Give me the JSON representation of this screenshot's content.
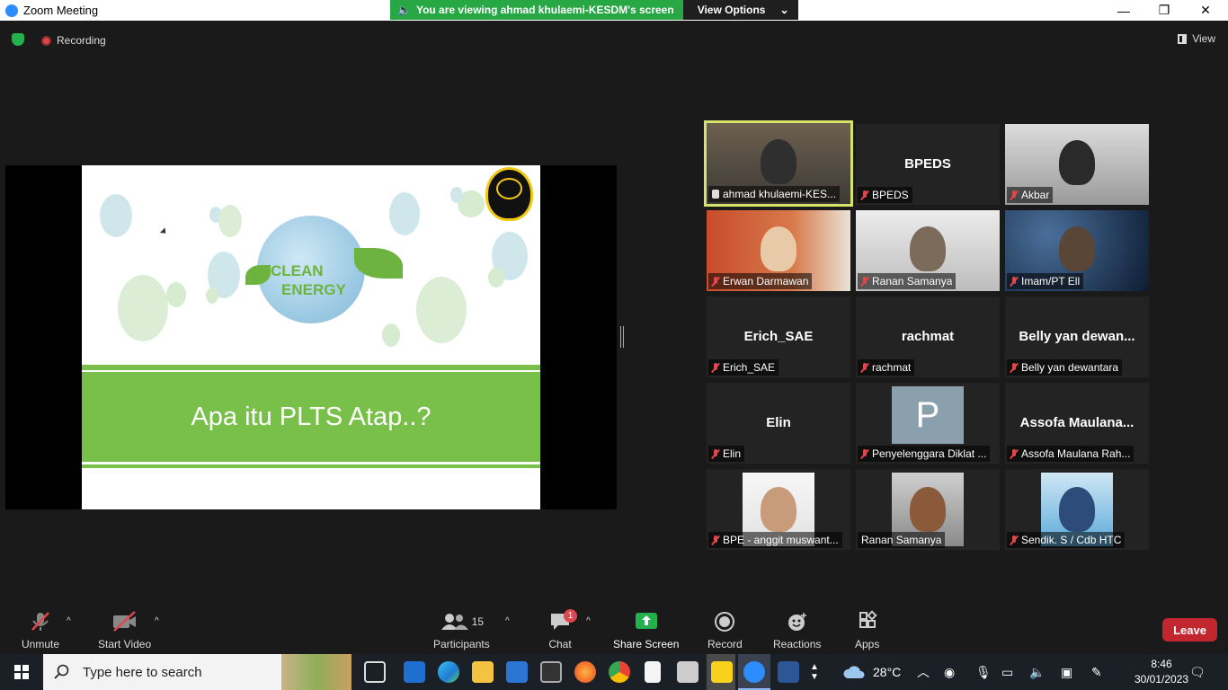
{
  "window": {
    "title": "Zoom Meeting",
    "minimize": "—",
    "restore": "❐",
    "close": "✕"
  },
  "share_banner": {
    "text": "You are viewing ahmad khulaemi-KESDM's screen",
    "options_label": "View Options",
    "chevron": "⌄"
  },
  "topbar": {
    "recording_label": "Recording",
    "view_label": "View"
  },
  "slide": {
    "logo_text": "CLEAN",
    "logo_text2": "ENERGY",
    "title": "Apa itu PLTS Atap..?"
  },
  "participants": [
    {
      "big": "",
      "caption": "ahmad khulaemi-KES...",
      "muted": false,
      "pinned": true,
      "active": true
    },
    {
      "big": "BPEDS",
      "caption": "BPEDS",
      "muted": true
    },
    {
      "big": "",
      "caption": "Akbar",
      "muted": true
    },
    {
      "big": "",
      "caption": "Erwan Darmawan",
      "muted": true
    },
    {
      "big": "",
      "caption": "Ranan Samanya",
      "muted": true
    },
    {
      "big": "",
      "caption": "Imam/PT Ell",
      "muted": true
    },
    {
      "big": "Erich_SAE",
      "caption": "Erich_SAE",
      "muted": true
    },
    {
      "big": "rachmat",
      "caption": "rachmat",
      "muted": true
    },
    {
      "big": "Belly yan dewan...",
      "caption": "Belly yan dewantara",
      "muted": true
    },
    {
      "big": "Elin",
      "caption": "Elin",
      "muted": true
    },
    {
      "big": "",
      "avatar_letter": "P",
      "caption": "Penyelenggara Diklat ...",
      "muted": true
    },
    {
      "big": "Assofa Maulana...",
      "caption": "Assofa Maulana Rah...",
      "muted": true
    },
    {
      "big": "",
      "caption": "BPE - anggit muswant...",
      "muted": true
    },
    {
      "big": "",
      "caption": "Ranan Samanya",
      "muted": false
    },
    {
      "big": "",
      "caption": "Sendik. S / Cdb HTC",
      "muted": true
    }
  ],
  "toolbar": {
    "unmute": "Unmute",
    "start_video": "Start Video",
    "participants": "Participants",
    "participants_count": "15",
    "chat": "Chat",
    "chat_badge": "1",
    "share_screen": "Share Screen",
    "record": "Record",
    "reactions": "Reactions",
    "apps": "Apps",
    "leave": "Leave",
    "caret": "^"
  },
  "taskbar": {
    "search_placeholder": "Type here to search",
    "weather": "28°C",
    "time": "8:46",
    "date": "30/01/2023"
  },
  "colors": {
    "share_green": "#28a745",
    "leave_red": "#c2262f",
    "slide_green": "#78c04a",
    "active_border": "#d5e36b"
  }
}
